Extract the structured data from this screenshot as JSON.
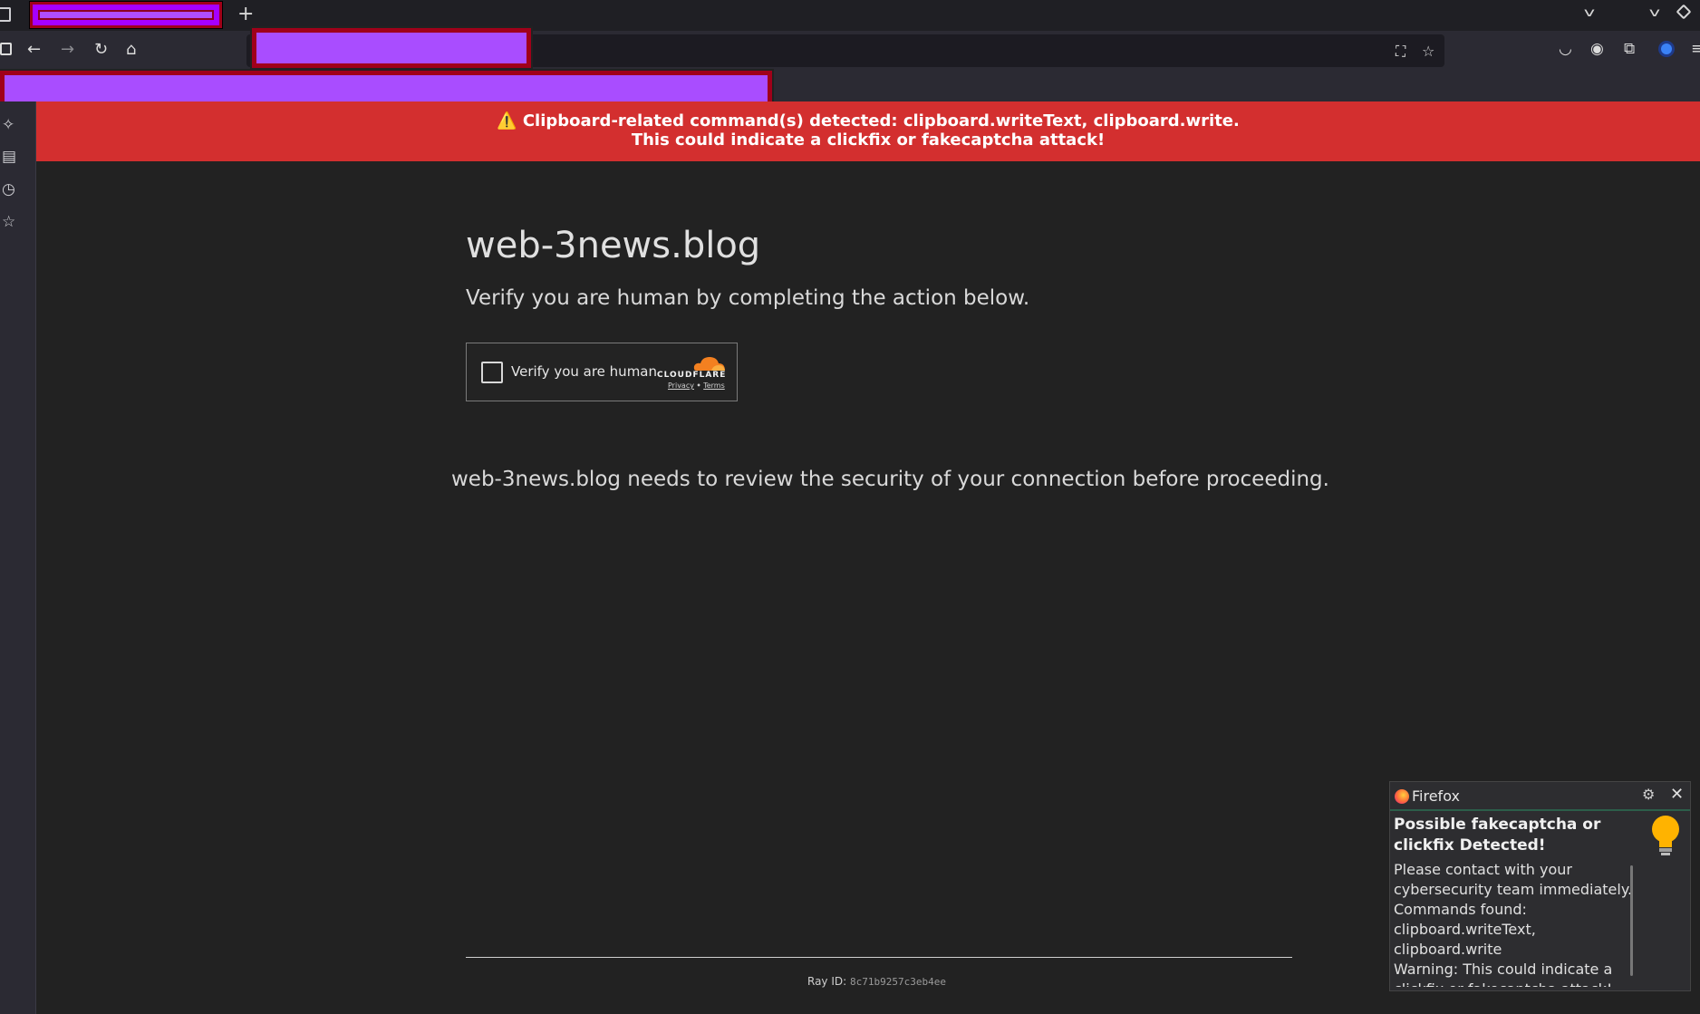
{
  "browser": {
    "new_tab_symbol": "+",
    "nav": {
      "back_icon": "back-arrow-icon",
      "forward_icon": "forward-arrow-icon",
      "reload_icon": "reload-icon",
      "home_icon": "home-icon"
    }
  },
  "banner": {
    "line1": "Clipboard-related command(s) detected: clipboard.writeText, clipboard.write.",
    "line2": "This could indicate a clickfix or fakecaptcha attack!",
    "warn_glyph": "⚠️",
    "color": "#d32f2f"
  },
  "page": {
    "title": "web-3news.blog",
    "subtitle": "Verify you are human by completing the action below.",
    "captcha": {
      "label": "Verify you are human",
      "brand": "CLOUDFLARE",
      "privacy": "Privacy",
      "separator": "•",
      "terms": "Terms"
    },
    "security_text": "web-3news.blog needs to review the security of your connection before proceeding.",
    "ray_label": "Ray ID:",
    "ray_id": "8c71b9257c3eb4ee"
  },
  "notification": {
    "app": "Firefox",
    "title": "Possible fakecaptcha or clickfix Detected!",
    "body_lines": [
      "Please contact with your cybersecurity team immediately.",
      "Commands found: clipboard.writeText, clipboard.write",
      "Warning: This could indicate a clickfix or fakecaptcha attack!"
    ]
  }
}
